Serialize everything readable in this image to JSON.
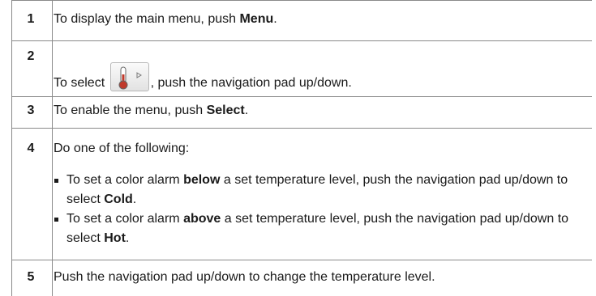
{
  "steps": [
    {
      "num": "1",
      "pre": "To display the main menu, push ",
      "bold": "Menu",
      "post": "."
    },
    {
      "num": "2",
      "pre": "To select ",
      "icon": "thermometer-icon",
      "post": ", push the navigation pad up/down."
    },
    {
      "num": "3",
      "pre": "To enable the menu, push ",
      "bold": "Select",
      "post": "."
    },
    {
      "num": "4",
      "intro": "Do one of the following:",
      "bullets": [
        {
          "pre": "To set a color alarm ",
          "bold": "below",
          "mid": " a set temperature level, push the navigation pad up/down to select ",
          "bold2": "Cold",
          "post": "."
        },
        {
          "pre": "To set a color alarm ",
          "bold": "above",
          "mid": " a set temperature level, push the navigation pad up/down to select ",
          "bold2": "Hot",
          "post": "."
        }
      ]
    },
    {
      "num": "5",
      "text": "Push the navigation pad up/down to change the temperature level."
    }
  ],
  "colors": {
    "rule": "#8a8a8a",
    "thermo_red": "#c0392b"
  }
}
